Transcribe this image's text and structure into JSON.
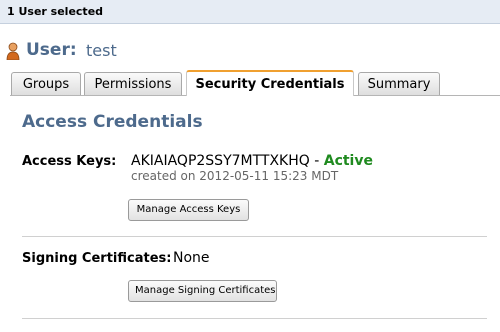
{
  "selection": {
    "text": "1 User selected"
  },
  "user": {
    "label": "User:",
    "name": "test"
  },
  "tabs": [
    {
      "label": "Groups",
      "active": false
    },
    {
      "label": "Permissions",
      "active": false
    },
    {
      "label": "Security Credentials",
      "active": true
    },
    {
      "label": "Summary",
      "active": false
    }
  ],
  "section": {
    "title": "Access Credentials"
  },
  "access_keys": {
    "label": "Access Keys:",
    "key_id": "AKIAIAQP2SSY7MTTXKHQ",
    "separator": " - ",
    "status": "Active",
    "created": "created on 2012-05-11 15:23 MDT",
    "button": "Manage Access Keys"
  },
  "signing_certificates": {
    "label": "Signing Certificates:",
    "value": "None",
    "button": "Manage Signing Certificates"
  },
  "colors": {
    "accent_blue": "#4d6a8c",
    "status_green": "#1f8a1f",
    "active_tab_border": "#f0a030",
    "topbar_bg": "#e6ecf4"
  },
  "icons": {
    "user": "user-icon"
  }
}
